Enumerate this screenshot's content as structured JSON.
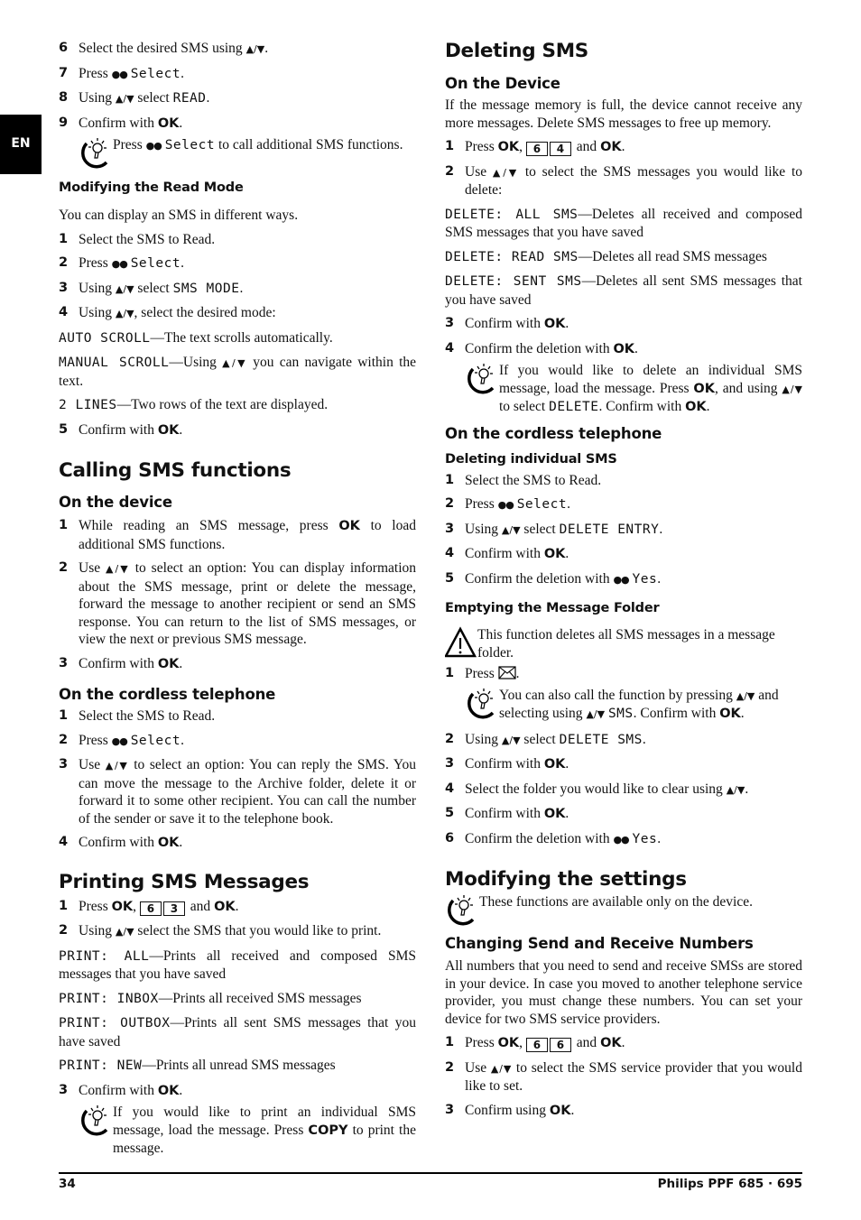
{
  "lang_tab": "EN",
  "left": {
    "top_steps": [
      {
        "num": "6",
        "a": "Select the desired SMS using ",
        "arrows": "▲/▼",
        "b": "."
      },
      {
        "num": "7",
        "a": "Press ",
        "dots": "●●",
        "mono": "Select",
        "b": "."
      },
      {
        "num": "8",
        "a": "Using ",
        "arrows": "▲/▼",
        "mid": " select ",
        "mono": "READ",
        "b": "."
      },
      {
        "num": "9",
        "a": "Confirm with ",
        "bold": "OK",
        "b": "."
      }
    ],
    "tip1": {
      "a": "Press ",
      "dots": "●●",
      "mono": "Select",
      "b": " to call additional SMS functions."
    },
    "read_mode": {
      "heading": "Modifying the Read Mode",
      "intro": "You can display an SMS in different ways.",
      "steps": [
        {
          "num": "1",
          "a": "Select the SMS to Read."
        },
        {
          "num": "2",
          "a": "Press ",
          "dots": "●●",
          "mono": "Select",
          "b": "."
        },
        {
          "num": "3",
          "a": "Using ",
          "arrows": "▲/▼",
          "mid": " select ",
          "mono": "SMS MODE",
          "b": "."
        },
        {
          "num": "4",
          "a": "Using ",
          "arrows": "▲/▼",
          "b": ", select the desired mode:"
        }
      ],
      "modes": [
        {
          "mono": "AUTO SCROLL",
          "text": "—The text scrolls automatically."
        },
        {
          "mono": "MANUAL SCROLL",
          "text": "—Using ",
          "arrows": "▲/▼",
          "text2": " you can navigate within the text."
        },
        {
          "mono": "2 LINES",
          "text": "—Two rows of the text are displayed."
        }
      ],
      "final_step": {
        "num": "5",
        "a": "Confirm with ",
        "bold": "OK",
        "b": "."
      }
    },
    "calling": {
      "heading": "Calling SMS functions",
      "device_heading": "On the device",
      "device_steps": [
        {
          "num": "1",
          "a": "While reading an SMS message, press ",
          "bold": "OK",
          "b": " to load additional SMS functions."
        },
        {
          "num": "2",
          "a": "Use ",
          "arrows": "▲/▼",
          "b": " to select an option: You can display information about the SMS message, print or delete the message, forward the message to another recipient or send an SMS response. You can return to the list of SMS messages, or view the next or previous SMS message."
        },
        {
          "num": "3",
          "a": "Confirm with ",
          "bold": "OK",
          "b": "."
        }
      ],
      "cordless_heading": "On the cordless telephone",
      "cordless_steps": [
        {
          "num": "1",
          "a": "Select the SMS to Read."
        },
        {
          "num": "2",
          "a": "Press ",
          "dots": "●●",
          "mono": "Select",
          "b": "."
        },
        {
          "num": "3",
          "a": "Use ",
          "arrows": "▲/▼",
          "b": " to select an option: You can reply the SMS. You can move the message to the Archive folder, delete it or forward it to some other recipient. You can call the number of the sender or save it to the telephone book."
        },
        {
          "num": "4",
          "a": "Confirm with ",
          "bold": "OK",
          "b": "."
        }
      ]
    },
    "printing": {
      "heading": "Printing SMS Messages",
      "step1": {
        "num": "1",
        "a": "Press ",
        "bold": "OK",
        "keys": [
          "6",
          "3"
        ],
        "mid": " and ",
        "bold2": "OK",
        "b": "."
      },
      "step2": {
        "num": "2",
        "a": "Using ",
        "arrows": "▲/▼",
        "b": " select the SMS that you would like to print."
      },
      "options": [
        {
          "mono": "PRINT: ALL",
          "text": "—Prints all received and composed SMS messages that you have saved"
        },
        {
          "mono": "PRINT: INBOX",
          "text": "—Prints all received SMS messages"
        },
        {
          "mono": "PRINT: OUTBOX",
          "text": "—Prints all sent SMS messages that you have saved"
        },
        {
          "mono": "PRINT: NEW",
          "text": "—Prints all unread SMS messages"
        }
      ],
      "step3": {
        "num": "3",
        "a": "Confirm with ",
        "bold": "OK",
        "b": "."
      },
      "tip": {
        "a": "If you would like to print an individual SMS message, load the message. Press ",
        "bold": "COPY",
        "b": " to print the message."
      }
    }
  },
  "right": {
    "deleting": {
      "heading": "Deleting SMS",
      "device_heading": "On the Device",
      "intro": "If the message memory is full, the device cannot receive any more messages. Delete SMS messages to free up memory.",
      "step1": {
        "num": "1",
        "a": "Press ",
        "bold": "OK",
        "keys": [
          "6",
          "4"
        ],
        "mid": " and ",
        "bold2": "OK",
        "b": "."
      },
      "step2": {
        "num": "2",
        "a": "Use ",
        "arrows": "▲/▼",
        "b": " to select the SMS messages you would like to delete:"
      },
      "options": [
        {
          "mono": "DELETE: ALL SMS",
          "text": "—Deletes all received and composed SMS messages that you have saved"
        },
        {
          "mono": "DELETE: READ SMS",
          "text": "—Deletes all read SMS messages"
        },
        {
          "mono": "DELETE: SENT SMS",
          "text": "—Deletes all sent SMS messages that you have saved"
        }
      ],
      "step3": {
        "num": "3",
        "a": "Confirm with ",
        "bold": "OK",
        "b": "."
      },
      "step4": {
        "num": "4",
        "a": "Confirm the deletion with ",
        "bold": "OK",
        "b": "."
      },
      "tip": {
        "a": "If you would like to delete an individual SMS message, load the message. Press ",
        "bold": "OK",
        "mid": ", and using ",
        "arrows": "▲/▼",
        "mid2": " to select ",
        "mono": "DELETE",
        "mid3": ". Confirm with ",
        "bold2": "OK",
        "b": "."
      },
      "cordless_heading": "On the cordless telephone",
      "individual_heading": "Deleting individual SMS",
      "individual_steps": [
        {
          "num": "1",
          "a": "Select the SMS to Read."
        },
        {
          "num": "2",
          "a": "Press ",
          "dots": "●●",
          "mono": "Select",
          "b": "."
        },
        {
          "num": "3",
          "a": "Using ",
          "arrows": "▲/▼",
          "mid": " select ",
          "mono": "DELETE ENTRY",
          "b": "."
        },
        {
          "num": "4",
          "a": "Confirm with ",
          "bold": "OK",
          "b": "."
        },
        {
          "num": "5",
          "a": "Confirm the deletion with ",
          "dots": "●●",
          "mono": "Yes",
          "b": "."
        }
      ],
      "folder_heading": "Emptying the Message Folder",
      "warning": "This function deletes all SMS messages in a message folder.",
      "folder_step1": {
        "num": "1",
        "a": "Press ",
        "b": "."
      },
      "folder_tip": {
        "a": "You can also call the function by pressing ",
        "arrows": "▲/▼",
        "mid": " and selecting using ",
        "arrows2": "▲/▼",
        "mono": "SMS",
        "mid2": ". Confirm with ",
        "bold": "OK",
        "b": "."
      },
      "folder_steps": [
        {
          "num": "2",
          "a": "Using ",
          "arrows": "▲/▼",
          "mid": " select ",
          "mono": "DELETE SMS",
          "b": "."
        },
        {
          "num": "3",
          "a": "Confirm with ",
          "bold": "OK",
          "b": "."
        },
        {
          "num": "4",
          "a": "Select the folder you would like to clear using ",
          "arrows": "▲/▼",
          "b": "."
        },
        {
          "num": "5",
          "a": "Confirm with ",
          "bold": "OK",
          "b": "."
        },
        {
          "num": "6",
          "a": "Confirm the deletion with ",
          "dots": "●●",
          "mono": "Yes",
          "b": "."
        }
      ]
    },
    "settings": {
      "heading": "Modifying the settings",
      "tip": "These functions are available only on the device.",
      "numbers_heading": "Changing Send and Receive Numbers",
      "intro": "All numbers that you need to send and receive SMSs are stored in your device. In case you moved to another telephone service provider, you must change these numbers. You can set your device for two SMS service providers.",
      "step1": {
        "num": "1",
        "a": "Press ",
        "bold": "OK",
        "keys": [
          "6",
          "6"
        ],
        "mid": " and ",
        "bold2": "OK",
        "b": "."
      },
      "step2": {
        "num": "2",
        "a": "Use ",
        "arrows": "▲/▼",
        "b": " to select the SMS service provider that you would like to set."
      },
      "step3": {
        "num": "3",
        "a": "Confirm using ",
        "bold": "OK",
        "b": "."
      }
    }
  },
  "footer": {
    "page_number": "34",
    "title": "Philips PPF 685 · 695"
  }
}
